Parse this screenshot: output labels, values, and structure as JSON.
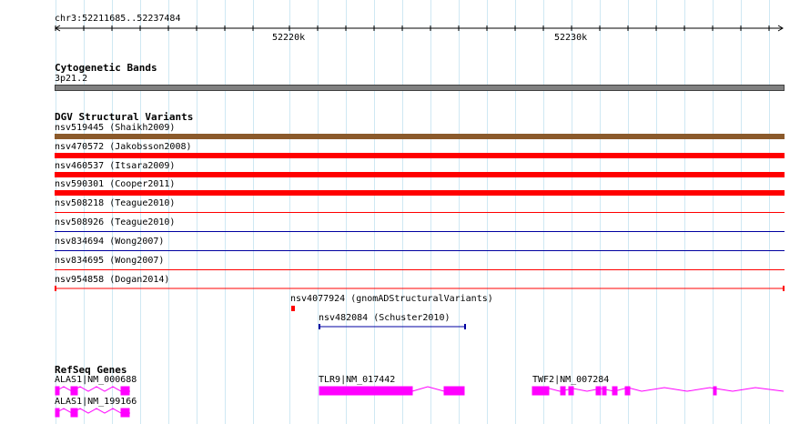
{
  "ruler": {
    "location": "chr3:52211685..52237484",
    "ticks": [
      {
        "label": "52220k"
      },
      {
        "label": "52230k"
      }
    ]
  },
  "cytoband_track": {
    "title": "Cytogenetic Bands",
    "band_label": "3p21.2",
    "band_color": "#808080"
  },
  "dgv_track": {
    "title": "DGV Structural Variants",
    "variants": [
      {
        "label": "nsv519445 (Shaikh2009)",
        "color": "#8b5a2b",
        "style": "thick"
      },
      {
        "label": "nsv470572 (Jakobsson2008)",
        "color": "#ff0000",
        "style": "thick"
      },
      {
        "label": "nsv460537 (Itsara2009)",
        "color": "#ff0000",
        "style": "thick"
      },
      {
        "label": "nsv590301 (Cooper2011)",
        "color": "#ff0000",
        "style": "thick"
      },
      {
        "label": "nsv508218 (Teague2010)",
        "color": "#ff0000",
        "style": "thin"
      },
      {
        "label": "nsv508926 (Teague2010)",
        "color": "#0000a0",
        "style": "thin"
      },
      {
        "label": "nsv834694 (Wong2007)",
        "color": "#0000a0",
        "style": "thin"
      },
      {
        "label": "nsv834695 (Wong2007)",
        "color": "#ff0000",
        "style": "thin"
      },
      {
        "label": "nsv954858 (Dogan2014)",
        "color": "#ff0000",
        "style": "capped"
      }
    ],
    "extra": [
      {
        "label": "nsv4077924 (gnomADStructuralVariants)",
        "color": "#ff0000"
      },
      {
        "label": "nsv482084 (Schuster2010)",
        "color": "#0000a0"
      }
    ]
  },
  "refseq_track": {
    "title": "RefSeq Genes",
    "gene_color": "#ff00ff",
    "genes": [
      {
        "label": "ALAS1|NM_000688"
      },
      {
        "label": "TLR9|NM_017442"
      },
      {
        "label": "TWF2|NM_007284"
      },
      {
        "label": "ALAS1|NM_199166"
      }
    ]
  }
}
